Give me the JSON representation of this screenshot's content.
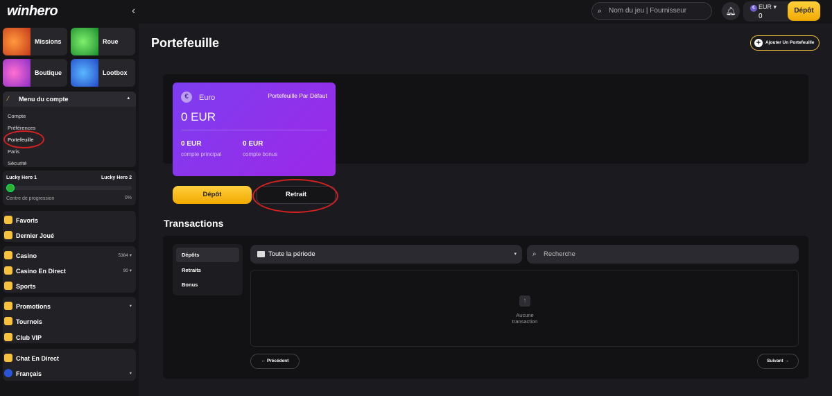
{
  "topbar": {
    "logo": "winhero",
    "search_placeholder": "Nom du jeu | Fournisseur",
    "currency": "EUR",
    "balance": "0",
    "deposit_label": "Dépôt"
  },
  "sidebar": {
    "tiles": [
      {
        "label": "Missions"
      },
      {
        "label": "Roue"
      },
      {
        "label": "Boutique"
      },
      {
        "label": "Lootbox"
      }
    ],
    "account_menu": {
      "title": "Menu du compte",
      "items": [
        "Compte",
        "Préférences",
        "Portefeuille",
        "Paris",
        "Sécurité"
      ]
    },
    "progress": {
      "left_label": "Lucky Hero 1",
      "right_label": "Lucky Hero 2",
      "caption": "Centre de progression",
      "percent": "0%",
      "value": 0
    },
    "favorites": [
      "Favoris",
      "Dernier Joué"
    ],
    "games": [
      {
        "label": "Casino",
        "count": "5384"
      },
      {
        "label": "Casino En Direct",
        "count": "90"
      },
      {
        "label": "Sports",
        "count": ""
      }
    ],
    "promo": [
      "Promotions",
      "Tournois",
      "Club VIP"
    ],
    "bottom": [
      "Chat En Direct",
      "Français"
    ]
  },
  "main": {
    "title": "Portefeuille",
    "add_wallet": "Ajouter Un Portefeuille",
    "card": {
      "currency_symbol": "€",
      "name": "Euro",
      "default_label": "Portefeuille Par Défaut",
      "total": "0 EUR",
      "main_value": "0 EUR",
      "main_label": "compte principal",
      "bonus_value": "0 EUR",
      "bonus_label": "compte bonus"
    },
    "deposit_button": "Dépôt",
    "withdraw_button": "Retrait",
    "transactions": {
      "title": "Transactions",
      "tabs": [
        "Dépôts",
        "Retraits",
        "Bonus"
      ],
      "period": "Toute la période",
      "search_placeholder": "Recherche",
      "empty_line1": "Aucune",
      "empty_line2": "transaction",
      "prev": "Précédent",
      "next": "Suivant"
    }
  },
  "colors": {
    "accent": "#f6c23e",
    "card": "#8a33ec",
    "annotation": "#d42020"
  }
}
